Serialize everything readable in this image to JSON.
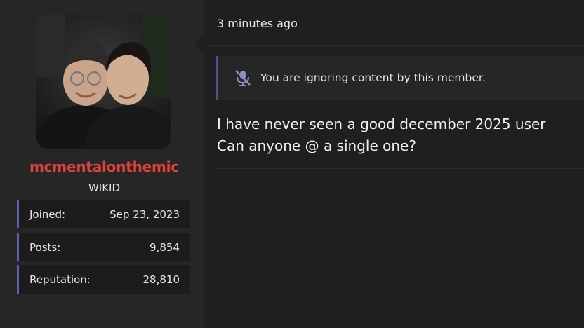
{
  "colors": {
    "username": "#e0413a",
    "stat_accent": "#5c5fb8",
    "notice_accent": "#4a5290",
    "icon": "#8a8fc8"
  },
  "user": {
    "username": "mcmentalonthemic",
    "title": "WIKID",
    "avatar_icon": "user-avatar-photo",
    "stats": [
      {
        "label": "Joined:",
        "value": "Sep 23, 2023"
      },
      {
        "label": "Posts:",
        "value": "9,854"
      },
      {
        "label": "Reputation:",
        "value": "28,810"
      }
    ]
  },
  "post": {
    "time": "3 minutes ago",
    "ignore_notice": {
      "icon": "muted-microphone-icon",
      "text": "You are ignoring content by this member."
    },
    "body_lines": [
      "I have never seen a good december 2025 user",
      "Can anyone @ a single one?"
    ]
  }
}
